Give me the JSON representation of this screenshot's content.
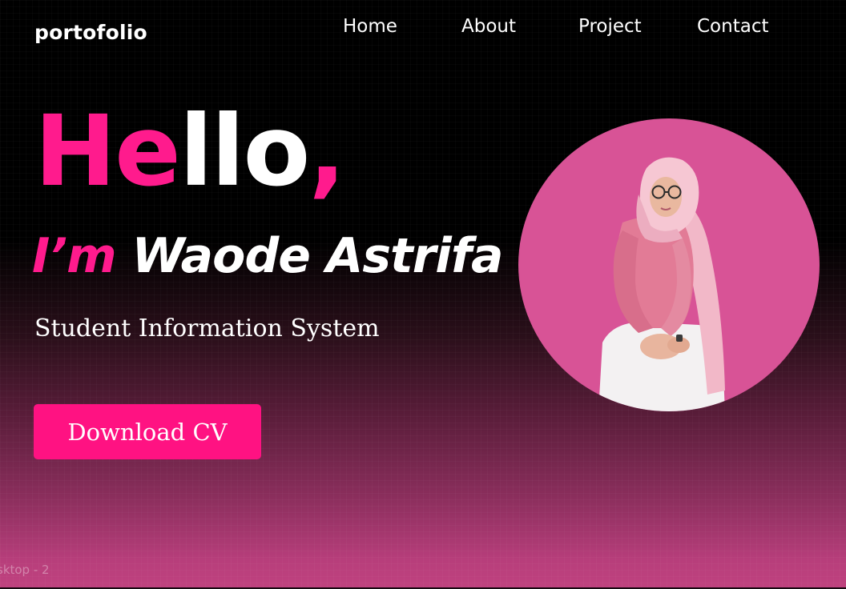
{
  "header": {
    "brand": "portofolio",
    "nav": {
      "home": "Home",
      "about": "About",
      "project": "Project",
      "contact": "Contact"
    }
  },
  "hero": {
    "hello_pink": "He",
    "hello_white": "llo",
    "hello_comma": ",",
    "intro_prefix": "I’m",
    "name": "Waode Astrifa S",
    "name_dot": ".",
    "role": "Student Information System",
    "cta": "Download CV"
  },
  "frame_label": "sktop - 2",
  "colors": {
    "accent": "#ff1b8d",
    "button": "#ff1282",
    "photo_bg": "#d85396",
    "gradient_bottom": "#c0427f"
  }
}
